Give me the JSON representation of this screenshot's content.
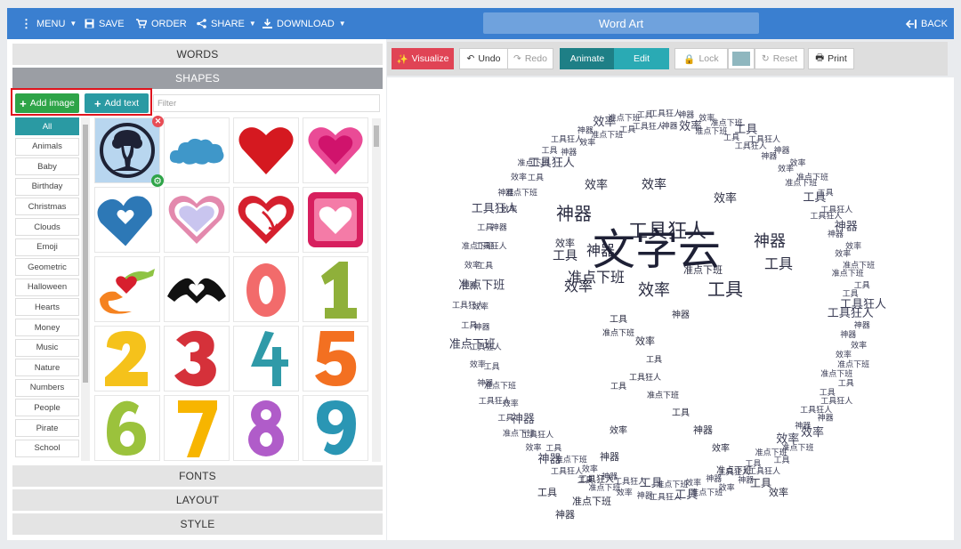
{
  "topbar": {
    "menu_label": "MENU",
    "save_label": "SAVE",
    "order_label": "ORDER",
    "share_label": "SHARE",
    "download_label": "DOWNLOAD",
    "title": "Word Art",
    "back_label": "BACK",
    "color": "#3a7fd0"
  },
  "left_panel": {
    "words_header": "WORDS",
    "shapes_header": "SHAPES",
    "fonts_header": "FONTS",
    "layout_header": "LAYOUT",
    "style_header": "STYLE",
    "add_image_label": "Add image",
    "add_text_label": "Add text",
    "filter_placeholder": "Filter",
    "categories": [
      "All",
      "Animals",
      "Baby",
      "Birthday",
      "Christmas",
      "Clouds",
      "Emoji",
      "Geometric",
      "Halloween",
      "Hearts",
      "Money",
      "Music",
      "Nature",
      "Numbers",
      "People",
      "Pirate",
      "School"
    ],
    "shapes": [
      "woman-head-circle",
      "cloud",
      "heart-red",
      "heart-pink",
      "heart-blue",
      "heart-outline-lavender",
      "heart-arrow",
      "heart-square",
      "hands-heart",
      "hands-heart-black",
      "number-0",
      "number-1",
      "number-2",
      "number-3",
      "number-4",
      "number-5",
      "number-6",
      "number-7",
      "number-8",
      "number-9"
    ]
  },
  "toolbar": {
    "visualize_label": "Visualize",
    "undo_label": "Undo",
    "redo_label": "Redo",
    "animate_label": "Animate",
    "edit_label": "Edit",
    "lock_label": "Lock",
    "reset_label": "Reset",
    "print_label": "Print",
    "swatch_color": "#8fb7bf"
  },
  "canvas": {
    "word_main": "文字云",
    "word_2": "工具狂人",
    "word_3": "神器",
    "word_4": "效率",
    "word_5": "准点下班",
    "word_6": "工具"
  }
}
